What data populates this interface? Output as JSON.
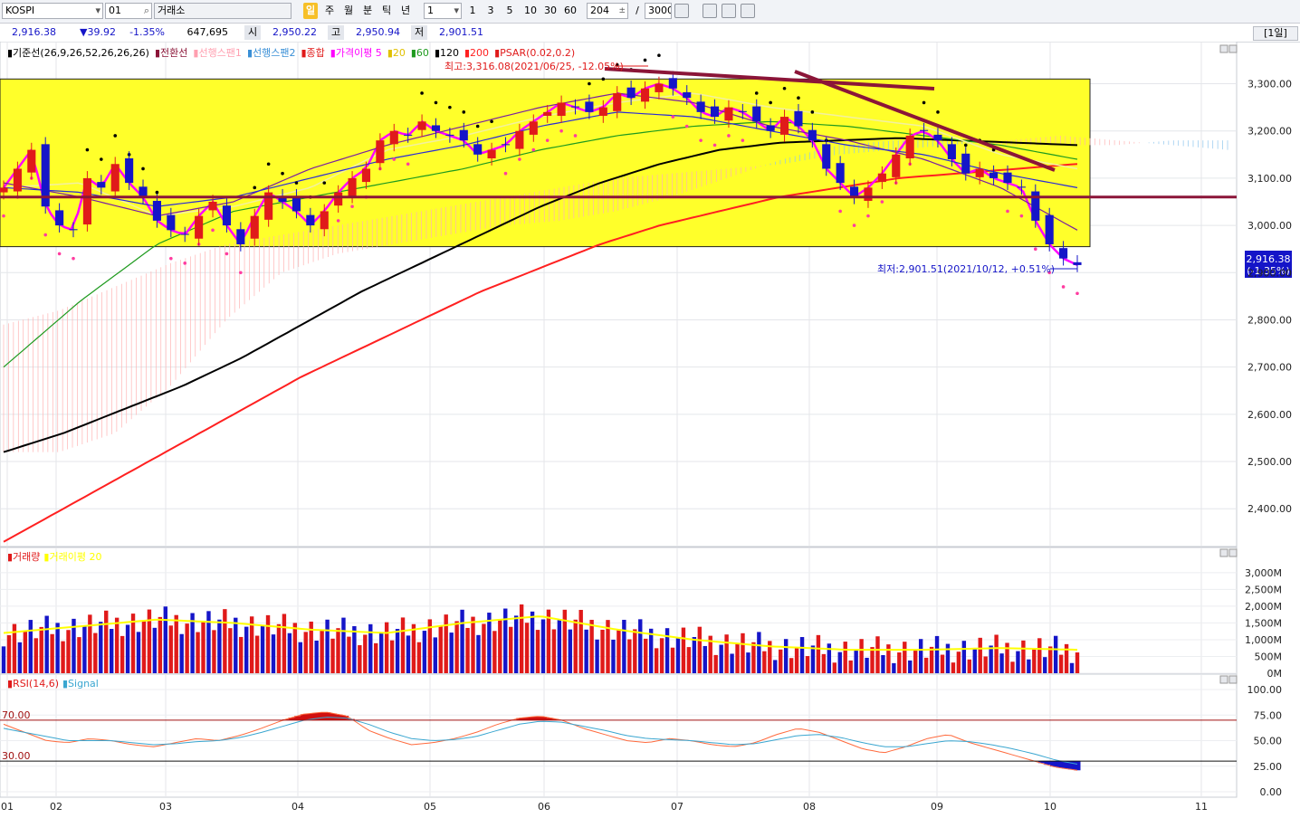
{
  "toolbar": {
    "symbol": "KOSPI",
    "code": "01",
    "market": "거래소",
    "periods": [
      "일",
      "주",
      "월",
      "분",
      "틱",
      "년"
    ],
    "selected_period": "일",
    "unit_value": "1",
    "intervals": [
      "1",
      "3",
      "5",
      "10",
      "30",
      "60"
    ],
    "bar_count": "204",
    "separator": "/",
    "total_count": "3000"
  },
  "infobar": {
    "price": "2,916.38",
    "change": "▼39.92",
    "change_pct": "-1.35%",
    "volume": "647,695",
    "open_label": "시",
    "open": "2,950.22",
    "high_label": "고",
    "high": "2,950.94",
    "low_label": "저",
    "low": "2,901.51",
    "period_button": "[1일]"
  },
  "colors": {
    "up": "#e01a1a",
    "down": "#1515c8",
    "box": "#ffff2a",
    "ma5": "#ff00ff",
    "ma20": "#ffff00",
    "ma60": "#1e9a1e",
    "ma120": "#000000",
    "ma200": "#ff2020",
    "psar": "#000000",
    "psar_rising": "#ff3ca0",
    "trendline": "#8b1538",
    "rsi": "#ff6a3d",
    "signal": "#3aa6d0"
  },
  "chart_data": [
    {
      "type": "candlestick",
      "title": "",
      "legend": [
        {
          "label": "기준선(26,9,26,52,26,26,26)",
          "color": "#000000"
        },
        {
          "label": "전환선",
          "color": "#8b1538"
        },
        {
          "label": "선행스팬1",
          "color": "#ffb6c1"
        },
        {
          "label": "선행스팬2",
          "color": "#3a8fd6"
        },
        {
          "label": "종합",
          "color": "#e01a1a"
        },
        {
          "label": "가격이평 5",
          "color": "#ff00ff"
        },
        {
          "label": "20",
          "color": "#e0c000"
        },
        {
          "label": "60",
          "color": "#1e9a1e"
        },
        {
          "label": "120",
          "color": "#000000"
        },
        {
          "label": "200",
          "color": "#ff2020"
        },
        {
          "label": "PSAR(0.02,0.2)",
          "color": "#e01a1a"
        }
      ],
      "x_labels": [
        "01",
        "02",
        "03",
        "04",
        "05",
        "06",
        "07",
        "08",
        "09",
        "10",
        "11"
      ],
      "y_ticks": [
        "3,300.00",
        "3,200.00",
        "3,100.00",
        "3,000.00",
        "2,900.00",
        "2,800.00",
        "2,700.00",
        "2,600.00",
        "2,500.00",
        "2,400.00"
      ],
      "ylim": [
        2320,
        3370
      ],
      "annotations": {
        "high": "최고:3,316.08(2021/06/25, -12.05%)",
        "low": "최저:2,901.51(2021/10/12, +0.51%)",
        "last_price": "2,916.38",
        "last_change": "(-1.35%)"
      },
      "price_box": {
        "top": 3310,
        "bottom": 2955
      },
      "support_line": 3060,
      "series": [
        {
          "name": "close",
          "values": [
            3080,
            3120,
            3160,
            3040,
            3000,
            2990,
            3100,
            3080,
            3130,
            3090,
            3060,
            3010,
            2990,
            2980,
            3020,
            3050,
            3000,
            2960,
            3020,
            3070,
            3050,
            3030,
            3000,
            3030,
            3070,
            3100,
            3120,
            3180,
            3200,
            3190,
            3220,
            3200,
            3190,
            3180,
            3150,
            3160,
            3170,
            3200,
            3220,
            3240,
            3260,
            3250,
            3240,
            3250,
            3280,
            3270,
            3290,
            3300,
            3290,
            3270,
            3240,
            3230,
            3250,
            3240,
            3220,
            3200,
            3230,
            3210,
            3180,
            3120,
            3090,
            3060,
            3080,
            3110,
            3150,
            3190,
            3200,
            3180,
            3140,
            3110,
            3120,
            3100,
            3090,
            3080,
            3010,
            2960,
            2930,
            2916
          ]
        }
      ]
    },
    {
      "type": "bar",
      "title": "",
      "legend": [
        {
          "label": "거래량",
          "color": "#e01a1a"
        },
        {
          "label": "거래이평 20",
          "color": "#ffff00"
        }
      ],
      "y_ticks": [
        "3,000M",
        "2,500M",
        "2,000M",
        "1,500M",
        "1,000M",
        "500M",
        "0M"
      ],
      "ylim": [
        0,
        3400
      ]
    },
    {
      "type": "line",
      "title": "",
      "legend": [
        {
          "label": "RSI(14,6)",
          "color": "#e01a1a"
        },
        {
          "label": "Signal",
          "color": "#3aa6d0"
        }
      ],
      "y_ticks": [
        "100.00",
        "75.00",
        "50.00",
        "25.00",
        "0.00"
      ],
      "ylim": [
        0,
        100
      ],
      "levels": [
        {
          "value": 70,
          "label": "70.00"
        },
        {
          "value": 30,
          "label": "30.00"
        }
      ]
    }
  ]
}
